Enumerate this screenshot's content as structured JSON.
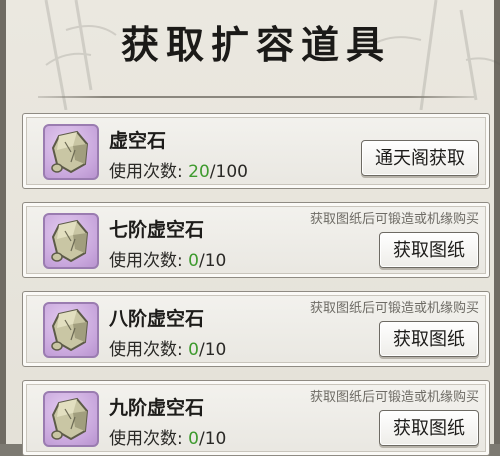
{
  "title": "获取扩容道具",
  "items": [
    {
      "name": "虚空石",
      "uses_label": "使用次数:",
      "uses_current": "20",
      "uses_sep": "/",
      "uses_max": "100",
      "hint": "",
      "button": "通天阁获取",
      "icon": "void-stone-icon"
    },
    {
      "name": "七阶虚空石",
      "uses_label": "使用次数:",
      "uses_current": "0",
      "uses_sep": "/",
      "uses_max": "10",
      "hint": "获取图纸后可锻造或机缘购买",
      "button": "获取图纸",
      "icon": "void-stone-icon"
    },
    {
      "name": "八阶虚空石",
      "uses_label": "使用次数:",
      "uses_current": "0",
      "uses_sep": "/",
      "uses_max": "10",
      "hint": "获取图纸后可锻造或机缘购买",
      "button": "获取图纸",
      "icon": "void-stone-icon"
    },
    {
      "name": "九阶虚空石",
      "uses_label": "使用次数:",
      "uses_current": "0",
      "uses_sep": "/",
      "uses_max": "10",
      "hint": "获取图纸后可锻造或机缘购买",
      "button": "获取图纸",
      "icon": "void-stone-icon"
    }
  ],
  "colors": {
    "accent_green": "#3e9a2e",
    "icon_bg": "#c8a6dc"
  }
}
